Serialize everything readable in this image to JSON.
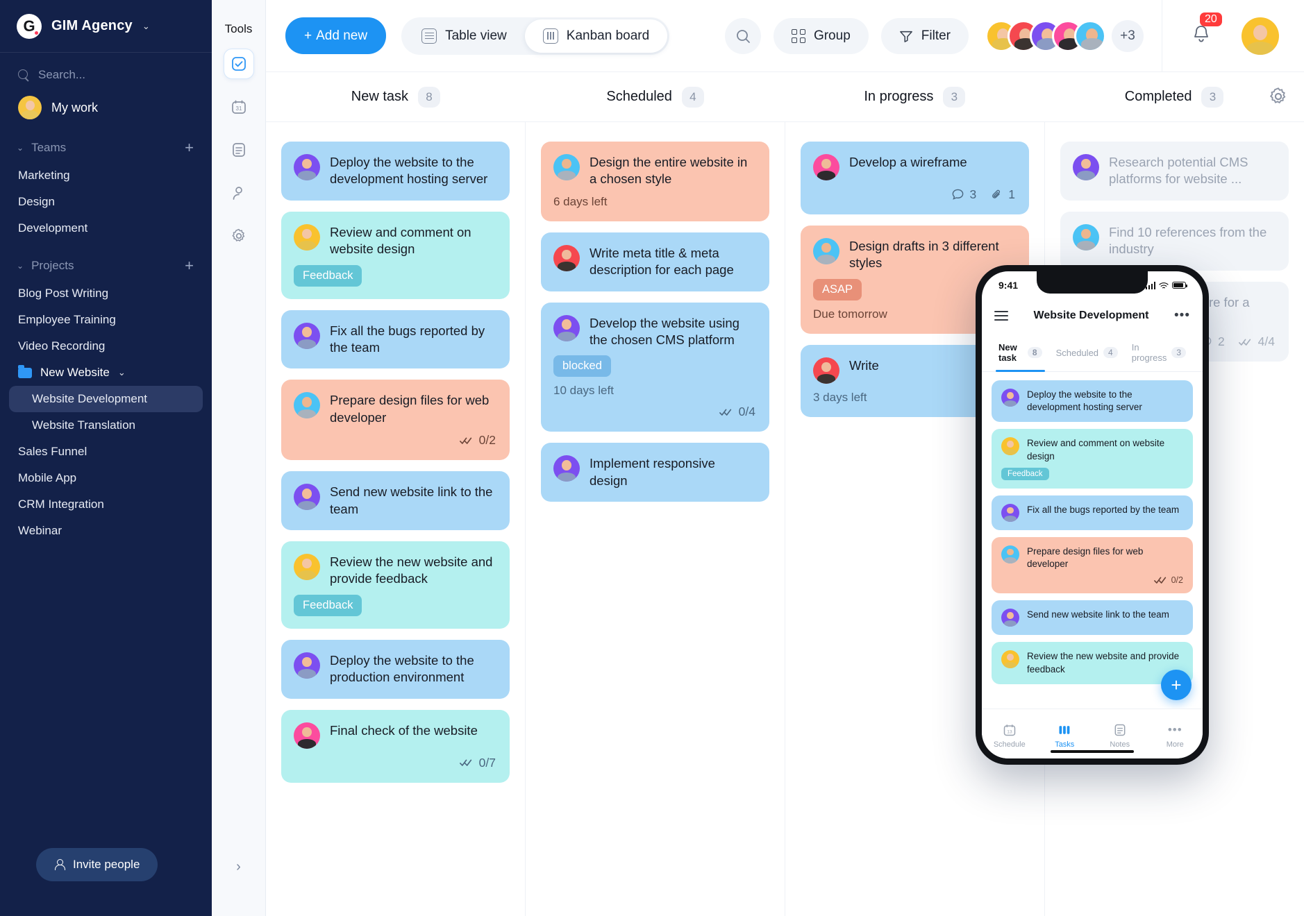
{
  "sidebar": {
    "brand": {
      "logo_letter": "G",
      "name": "GIM Agency",
      "chevron": "⌄"
    },
    "search_placeholder": "Search...",
    "my_work": "My work",
    "teams_header": "Teams",
    "teams": [
      "Marketing",
      "Design",
      "Development"
    ],
    "projects_header": "Projects",
    "projects": [
      {
        "label": "Blog Post Writing",
        "type": "item"
      },
      {
        "label": "Employee Training",
        "type": "item"
      },
      {
        "label": "Video Recording",
        "type": "item"
      },
      {
        "label": "New Website",
        "type": "folder"
      },
      {
        "label": "Website Development",
        "type": "sub",
        "active": true
      },
      {
        "label": "Website Translation",
        "type": "sub"
      },
      {
        "label": "Sales Funnel",
        "type": "item"
      },
      {
        "label": "Mobile App",
        "type": "item"
      },
      {
        "label": "CRM Integration",
        "type": "item"
      },
      {
        "label": "Webinar",
        "type": "item"
      }
    ],
    "invite_label": "Invite people",
    "add_symbol": "+"
  },
  "tools": {
    "title": "Tools",
    "items": [
      "checkbox-icon",
      "calendar-icon",
      "notes-icon",
      "contacts-icon",
      "settings-icon"
    ],
    "calendar_day": "31",
    "expand": "›"
  },
  "topbar": {
    "add_new": "Add new",
    "add_new_plus": "+",
    "table_view": "Table view",
    "kanban_board": "Kanban board",
    "group": "Group",
    "filter": "Filter",
    "avatar_overflow": "+3",
    "notification_count": "20"
  },
  "board": {
    "columns": [
      {
        "title": "New task",
        "count": "8",
        "cards": [
          {
            "title": "Deploy the website to the development hosting server",
            "color": "c-blue",
            "avatar": "purple"
          },
          {
            "title": "Review and comment on website design",
            "color": "c-mint",
            "avatar": "yellow",
            "tag": "Feedback",
            "tag_class": "tag-feedback"
          },
          {
            "title": "Fix all the bugs reported by the team",
            "color": "c-blue",
            "avatar": "purple"
          },
          {
            "title": "Prepare design files for web developer",
            "color": "c-peach",
            "avatar": "cyan",
            "checklist": "0/2"
          },
          {
            "title": "Send new website link to the team",
            "color": "c-blue",
            "avatar": "purple"
          },
          {
            "title": "Review the new website and provide feedback",
            "color": "c-mint",
            "avatar": "yellow",
            "tag": "Feedback",
            "tag_class": "tag-feedback"
          },
          {
            "title": "Deploy the website to the production environment",
            "color": "c-blue",
            "avatar": "purple"
          },
          {
            "title": "Final check of the website",
            "color": "c-mint",
            "avatar": "pink",
            "checklist": "0/7"
          }
        ]
      },
      {
        "title": "Scheduled",
        "count": "4",
        "cards": [
          {
            "title": "Design the entire website in a chosen style",
            "color": "c-peach",
            "avatar": "cyan",
            "meta": "6 days left"
          },
          {
            "title": "Write meta title & meta description for each page",
            "color": "c-blue",
            "avatar": "red"
          },
          {
            "title": "Develop the website using the chosen CMS platform",
            "color": "c-blue",
            "avatar": "purple",
            "tag": "blocked",
            "tag_class": "tag-blocked",
            "meta": "10 days left",
            "checklist": "0/4"
          },
          {
            "title": "Implement responsive design",
            "color": "c-blue",
            "avatar": "purple"
          }
        ]
      },
      {
        "title": "In progress",
        "count": "3",
        "cards": [
          {
            "title": "Develop a wireframe",
            "color": "c-blue",
            "avatar": "pink",
            "comments": "3",
            "attachments": "1"
          },
          {
            "title": "Design drafts in 3 different styles",
            "color": "c-peach",
            "avatar": "cyan",
            "tag": "ASAP",
            "tag_class": "tag-asap",
            "meta": "Due tomorrow"
          },
          {
            "title": "Write",
            "color": "c-blue",
            "avatar": "red",
            "meta": "3 days left"
          }
        ]
      },
      {
        "title": "Completed",
        "count": "3",
        "cards": [
          {
            "title": "Research potential CMS platforms for website ...",
            "color": "c-gray",
            "avatar": "purple",
            "done": true
          },
          {
            "title": "Find 10 references from the industry",
            "color": "c-gray",
            "avatar": "cyan",
            "done": true
          },
          {
            "title": "Develop a structure for a website",
            "color": "c-gray",
            "avatar": "pink",
            "done": true,
            "comments": "2",
            "checklist": "4/4"
          }
        ]
      }
    ]
  },
  "phone": {
    "status_time": "9:41",
    "title": "Website Development",
    "tabs": [
      {
        "label": "New task",
        "count": "8",
        "active": true
      },
      {
        "label": "Scheduled",
        "count": "4"
      },
      {
        "label": "In progress",
        "count": "3"
      }
    ],
    "cards": [
      {
        "title": "Deploy the website to the development hosting server",
        "color": "c-blue",
        "avatar": "purple"
      },
      {
        "title": "Review and comment on website design",
        "color": "c-mint",
        "avatar": "yellow",
        "tag": "Feedback",
        "tag_class": "tag-feedback"
      },
      {
        "title": "Fix all the bugs reported by the team",
        "color": "c-blue",
        "avatar": "purple"
      },
      {
        "title": "Prepare design files for web developer",
        "color": "c-peach",
        "avatar": "cyan",
        "checklist": "0/2"
      },
      {
        "title": "Send new website link to the team",
        "color": "c-blue",
        "avatar": "purple"
      },
      {
        "title": "Review the new website and provide feedback",
        "color": "c-mint",
        "avatar": "yellow"
      }
    ],
    "fab": "+",
    "tabbar": [
      {
        "label": "Schedule",
        "icon": "calendar-icon",
        "day": "13"
      },
      {
        "label": "Tasks",
        "icon": "columns-icon",
        "active": true
      },
      {
        "label": "Notes",
        "icon": "notes-icon"
      },
      {
        "label": "More",
        "icon": "more-icon"
      }
    ]
  },
  "colors": {
    "sidebar_bg": "#132149",
    "accent": "#1d93f3",
    "card_blue": "#aad8f7",
    "card_mint": "#b4f0ef",
    "card_peach": "#fbc4b0",
    "card_gray": "#f1f4f8",
    "badge_red": "#ff3b3b"
  }
}
